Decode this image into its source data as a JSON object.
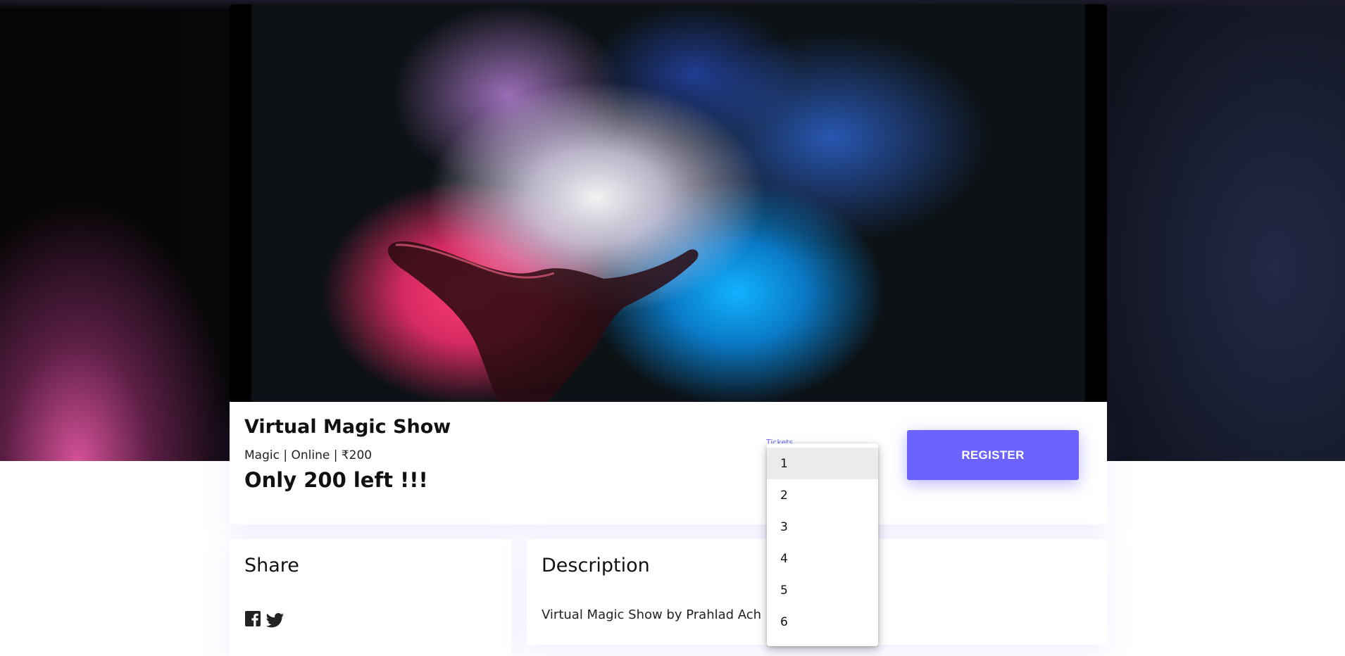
{
  "event": {
    "title": "Virtual Magic Show",
    "meta": "Magic | Online | ₹200",
    "availability": "Only 200 left !!!"
  },
  "tickets": {
    "label": "Tickets",
    "options": [
      "1",
      "2",
      "3",
      "4",
      "5",
      "6"
    ],
    "highlighted": "1"
  },
  "actions": {
    "register_label": "REGISTER"
  },
  "share": {
    "heading": "Share",
    "icons": [
      "facebook-icon",
      "twitter-icon"
    ]
  },
  "description": {
    "heading": "Description",
    "text": "Virtual Magic Show by Prahlad Ach"
  },
  "colors": {
    "accent": "#6c63ff",
    "text": "#111111",
    "dropdown_highlight": "#ebebeb"
  }
}
